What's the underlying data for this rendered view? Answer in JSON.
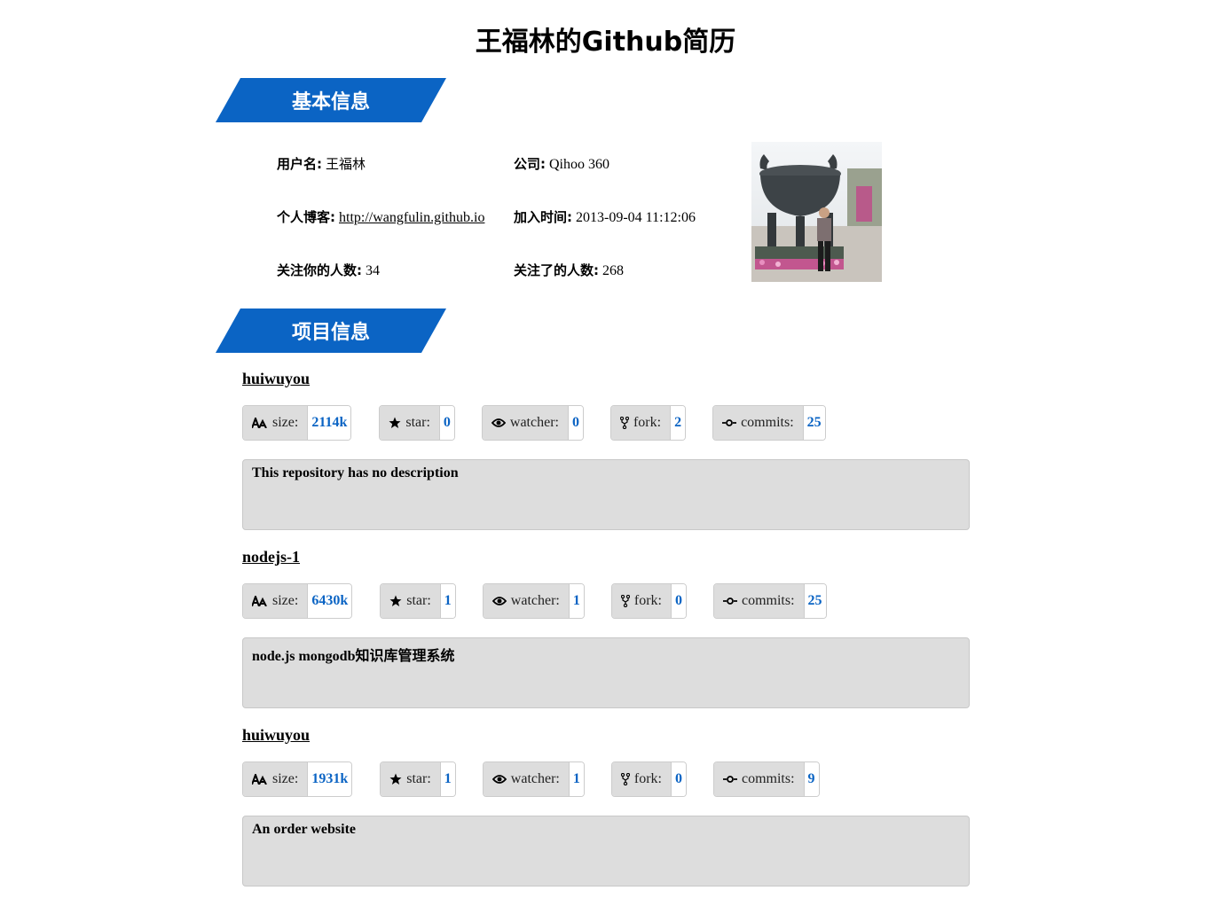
{
  "title": "王福林的Github简历",
  "sections": {
    "basic": "基本信息",
    "projects": "项目信息"
  },
  "profile": {
    "username_label": "用户名:",
    "username": "王福林",
    "company_label": "公司:",
    "company": "Qihoo 360",
    "blog_label": "个人博客:",
    "blog": "http://wangfulin.github.io",
    "joined_label": "加入时间:",
    "joined": "2013-09-04 11:12:06",
    "followers_label": "关注你的人数:",
    "followers": "34",
    "following_label": "关注了的人数:",
    "following": "268"
  },
  "stat_labels": {
    "size": "size:",
    "star": "star:",
    "watcher": "watcher:",
    "fork": "fork:",
    "commits": "commits:"
  },
  "repos": [
    {
      "name": "huiwuyou",
      "size": "2114k",
      "star": "0",
      "watcher": "0",
      "fork": "2",
      "commits": "25",
      "description": "This repository has no description"
    },
    {
      "name": "nodejs-1",
      "size": "6430k",
      "star": "1",
      "watcher": "1",
      "fork": "0",
      "commits": "25",
      "description": "node.js mongodb知识库管理系统"
    },
    {
      "name": "huiwuyou",
      "size": "1931k",
      "star": "1",
      "watcher": "1",
      "fork": "0",
      "commits": "9",
      "description": "An order website"
    }
  ],
  "icons": {
    "size": "text-size-icon",
    "star": "star-icon",
    "watcher": "eye-icon",
    "fork": "fork-icon",
    "commits": "commit-icon"
  },
  "colors": {
    "accent": "#0b64c4",
    "panel": "#dddddd"
  }
}
